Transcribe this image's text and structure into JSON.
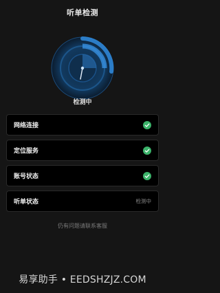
{
  "header": {
    "title": "听单检测"
  },
  "scan": {
    "status_text": "检测中"
  },
  "checks": [
    {
      "label": "网络连接",
      "state": "ok",
      "icon": "check-circle-icon"
    },
    {
      "label": "定位服务",
      "state": "ok",
      "icon": "check-circle-icon"
    },
    {
      "label": "账号状态",
      "state": "ok",
      "icon": "check-circle-icon"
    },
    {
      "label": "听单状态",
      "state": "checking",
      "status_text": "检测中"
    }
  ],
  "footer": {
    "help_text": "仍有问题请联系客服"
  },
  "watermark": {
    "text": "易享助手 • EEDSHZJZ.COM"
  },
  "colors": {
    "background": "#151515",
    "radar_blue": "#2f86d6",
    "check_green": "#3bb36a"
  }
}
